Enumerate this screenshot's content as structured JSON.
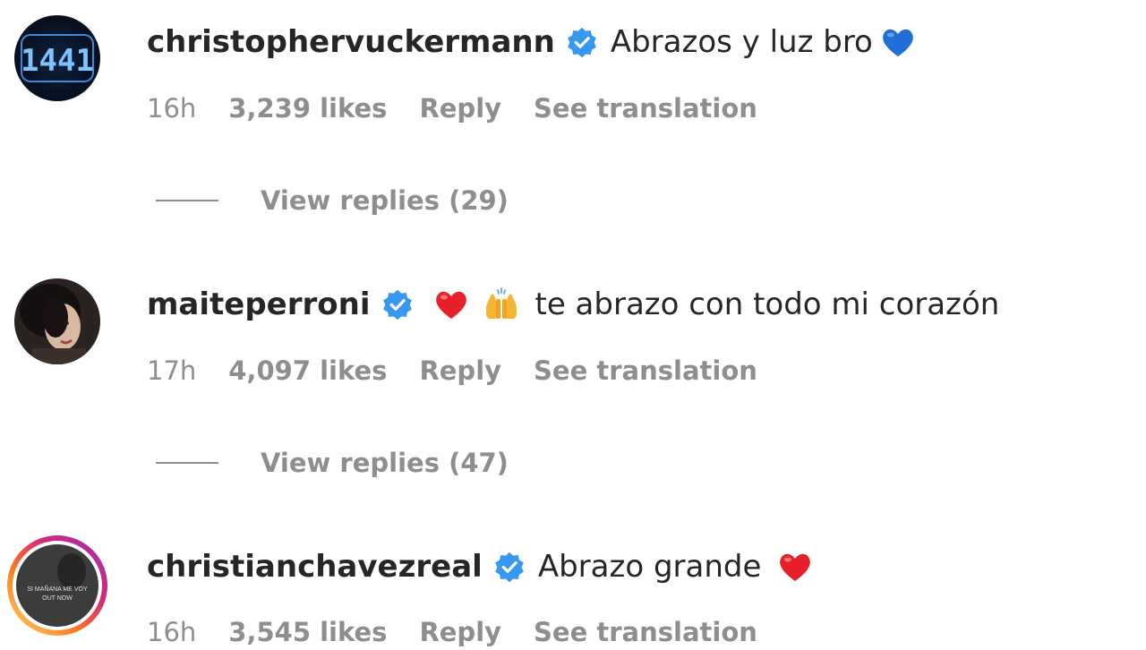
{
  "comments": [
    {
      "username": "christophervuckermann",
      "verified": true,
      "text": "Abrazos y luz bro",
      "emojis": [
        "blue-heart"
      ],
      "time": "16h",
      "likes": "3,239 likes",
      "reply": "Reply",
      "translate": "See translation",
      "view_replies": "View replies (29)",
      "avatar_text": "1441"
    },
    {
      "username": "maiteperroni",
      "verified": true,
      "text": "te abrazo con todo mi corazón",
      "emojis": [
        "red-heart",
        "raising-hands"
      ],
      "time": "17h",
      "likes": "4,097 likes",
      "reply": "Reply",
      "translate": "See translation",
      "view_replies": "View replies (47)"
    },
    {
      "username": "christianchavezreal",
      "verified": true,
      "text": "Abrazo grande",
      "emojis": [
        "red-heart"
      ],
      "time": "16h",
      "likes": "3,545 likes",
      "reply": "Reply",
      "translate": "See translation",
      "avatar_text_1": "SI MAÑANA ME VOY",
      "avatar_text_2": "OUT NOW",
      "has_story_ring": true
    }
  ],
  "colors": {
    "text": "#262626",
    "secondary": "#8e8e8e",
    "verified": "#3897f0",
    "heart_red": "#e8202b",
    "heart_blue": "#1f6fd6"
  }
}
